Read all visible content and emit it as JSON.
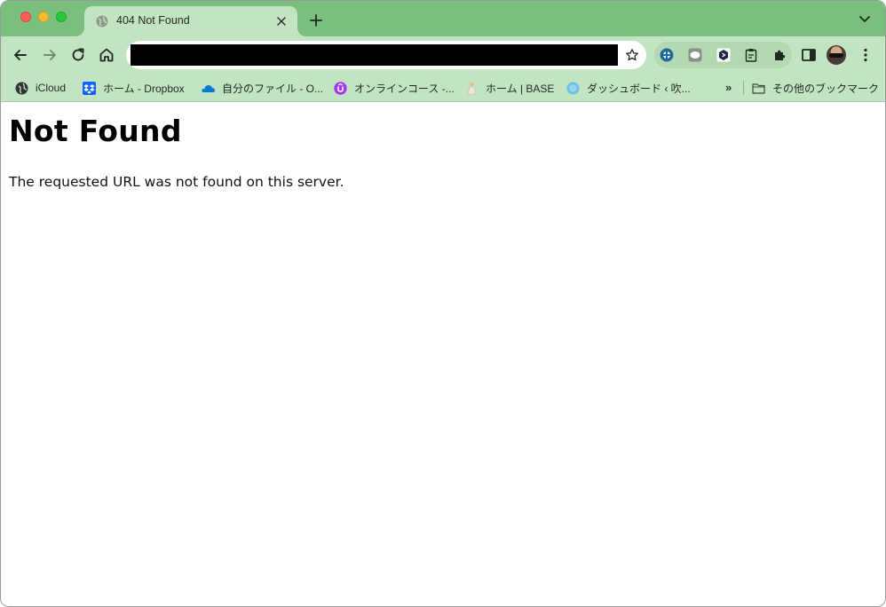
{
  "window": {
    "tab": {
      "title": "404 Not Found",
      "favicon": "globe-icon"
    }
  },
  "toolbar": {
    "address_value": "",
    "icons": [
      "back-arrow-icon",
      "forward-arrow-icon",
      "reload-icon",
      "home-icon",
      "bookmark-star-icon",
      "extensions-puzzle-icon",
      "side-panel-icon",
      "more-menu-icon"
    ]
  },
  "bookmarks": [
    {
      "label": "iCloud",
      "icon": "icloud-icon"
    },
    {
      "label": "ホーム - Dropbox",
      "icon": "dropbox-icon"
    },
    {
      "label": "自分のファイル - O...",
      "icon": "onedrive-icon"
    },
    {
      "label": "オンラインコース -...",
      "icon": "udemy-icon"
    },
    {
      "label": "ホーム | BASE",
      "icon": "base-icon"
    },
    {
      "label": "ダッシュボード ‹ 吹...",
      "icon": "wordpress-icon"
    }
  ],
  "other_bookmarks": "その他のブックマーク",
  "page": {
    "heading": "Not Found",
    "message": "The requested URL was not found on this server."
  },
  "colors": {
    "frame": "#7bbf7f",
    "toolbar": "#c3e4c2"
  }
}
